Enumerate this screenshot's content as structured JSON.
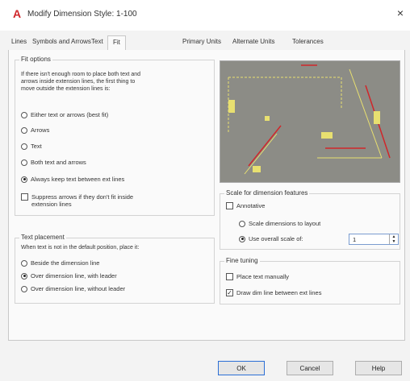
{
  "window": {
    "title": "Modify Dimension Style: 1-100",
    "close": "×",
    "app_icon": "autocad-a-icon"
  },
  "tabs": [
    {
      "label": "Lines"
    },
    {
      "label": "Symbols and Arrows"
    },
    {
      "label": "Text"
    },
    {
      "label": "Fit",
      "active": true
    },
    {
      "label": "Primary Units"
    },
    {
      "label": "Alternate Units"
    },
    {
      "label": "Tolerances"
    }
  ],
  "fit_options": {
    "title": "Fit options",
    "desc1": "If there isn't enough room to place both text and",
    "desc2": "arrows inside extension lines, the first thing to",
    "desc3": "move outside the extension lines is:",
    "options": [
      {
        "label": "Either text or arrows (best fit)",
        "selected": false
      },
      {
        "label": "Arrows",
        "selected": false
      },
      {
        "label": "Text",
        "selected": false
      },
      {
        "label": "Both text and arrows",
        "selected": false
      },
      {
        "label": "Always keep text between ext lines",
        "selected": true
      }
    ],
    "suppress_l1": "Suppress arrows if they don't fit inside",
    "suppress_l2": "extension lines",
    "suppress_checked": false
  },
  "text_placement": {
    "title": "Text placement",
    "desc": "When text is not in the default position, place it:",
    "options": [
      {
        "label": "Beside the dimension line",
        "selected": false
      },
      {
        "label": "Over dimension line, with leader",
        "selected": true
      },
      {
        "label": "Over dimension line, without leader",
        "selected": false
      }
    ]
  },
  "scale": {
    "title": "Scale for dimension features",
    "annotative": "Annotative",
    "scale_to_layout": "Scale dimensions to layout",
    "use_overall": "Use overall scale of:",
    "overall_value": "1"
  },
  "fine_tuning": {
    "title": "Fine tuning",
    "place_manually": "Place text manually",
    "draw_dim_line": "Draw dim line between ext lines",
    "place_manually_checked": false,
    "draw_dim_line_checked": true
  },
  "buttons": {
    "ok": "OK",
    "cancel": "Cancel",
    "help": "Help"
  },
  "colors": {
    "preview_bg": "#8c8c86",
    "accent_red": "#d0262a",
    "dim_yellow": "#e8e070"
  }
}
